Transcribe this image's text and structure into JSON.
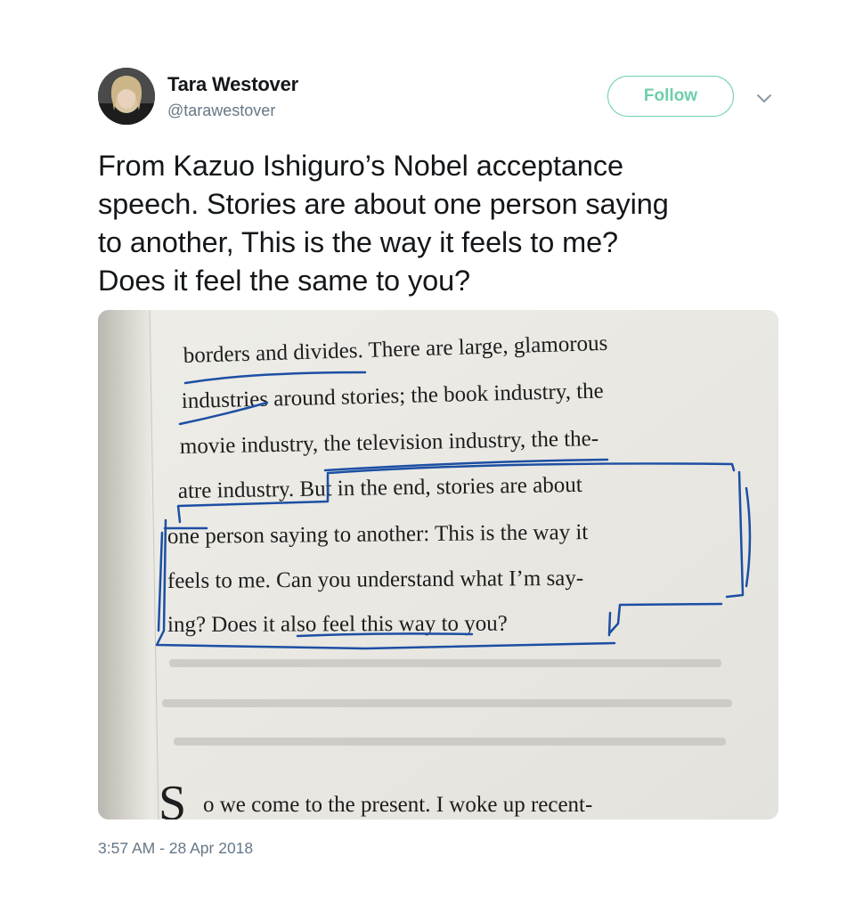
{
  "tweet": {
    "author": {
      "display_name": "Tara Westover",
      "handle": "@tarawestover"
    },
    "follow_label": "Follow",
    "text_lines": [
      "From Kazuo Ishiguro’s Nobel acceptance",
      "speech. Stories are about one person saying",
      "to another, This is the way it feels to me?",
      "Does it feel the same to you?"
    ],
    "timestamp": "3:57 AM - 28 Apr 2018"
  },
  "photo": {
    "book_lines": [
      "borders and divides. There are large, glamorous",
      "industries around stories; the book industry, the",
      "movie industry, the television industry, the the-",
      "atre industry. But in the end, stories are about",
      "one person saying to another: This is the way it",
      "feels to me. Can you understand what I’m say-",
      "ing? Does it also feel this way to you?",
      "o we come to the present. I woke up recent-"
    ],
    "drop_cap": "S",
    "annotation_color": "#1c4fa3"
  },
  "colors": {
    "follow_accent": "#6dcfa9",
    "secondary_text": "#657786",
    "primary_text": "#14171a"
  }
}
